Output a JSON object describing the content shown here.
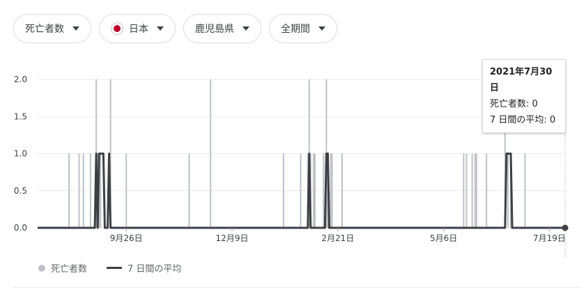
{
  "filters": {
    "metric": "死亡者数",
    "country": "日本",
    "region": "鹿児島県",
    "period": "全期間"
  },
  "tooltip": {
    "date": "2021年7月30日",
    "deaths_label": "死亡者数",
    "deaths_value": "0",
    "avg_label": "7 日間の平均",
    "avg_value": "0"
  },
  "legend": {
    "deaths": "死亡者数",
    "avg": "7 日間の平均"
  },
  "colors": {
    "bars": "#bdc1c6",
    "line": "#3c4043",
    "grid": "#e8eaed",
    "flag": "#bc002d"
  },
  "chart_data": {
    "type": "bar",
    "title": "",
    "xlabel": "",
    "ylabel": "",
    "x_range": [
      "2020-07-26",
      "2021-07-30"
    ],
    "ylim": [
      0,
      2.0
    ],
    "yticks": [
      "0.0",
      "0.5",
      "1.0",
      "1.5",
      "2.0"
    ],
    "xticks": [
      {
        "date": "2020-09-26",
        "label": "9月26日"
      },
      {
        "date": "2020-12-09",
        "label": "12月9日"
      },
      {
        "date": "2021-02-21",
        "label": "2月21日"
      },
      {
        "date": "2021-05-06",
        "label": "5月6日"
      },
      {
        "date": "2021-07-19",
        "label": "7月19日"
      }
    ],
    "grid": true,
    "legend_position": "bottom-left",
    "series": [
      {
        "name": "死亡者数",
        "type": "bar",
        "points": [
          [
            "2020-08-17",
            1
          ],
          [
            "2020-08-24",
            1
          ],
          [
            "2020-08-27",
            1
          ],
          [
            "2020-09-01",
            1
          ],
          [
            "2020-09-05",
            2
          ],
          [
            "2020-09-06",
            1
          ],
          [
            "2020-09-07",
            1
          ],
          [
            "2020-09-08",
            1
          ],
          [
            "2020-09-15",
            2
          ],
          [
            "2020-09-26",
            1
          ],
          [
            "2020-11-09",
            1
          ],
          [
            "2020-11-24",
            2
          ],
          [
            "2021-01-14",
            1
          ],
          [
            "2021-01-26",
            1
          ],
          [
            "2021-01-31",
            1
          ],
          [
            "2021-02-01",
            2
          ],
          [
            "2021-02-02",
            1
          ],
          [
            "2021-02-04",
            1
          ],
          [
            "2021-02-05",
            1
          ],
          [
            "2021-02-11",
            1
          ],
          [
            "2021-02-13",
            2
          ],
          [
            "2021-02-14",
            1
          ],
          [
            "2021-02-16",
            1
          ],
          [
            "2021-02-17",
            1
          ],
          [
            "2021-02-24",
            1
          ],
          [
            "2021-05-20",
            1
          ],
          [
            "2021-05-22",
            1
          ],
          [
            "2021-05-26",
            1
          ],
          [
            "2021-05-28",
            1
          ],
          [
            "2021-05-29",
            1
          ],
          [
            "2021-06-05",
            1
          ],
          [
            "2021-06-18",
            2
          ],
          [
            "2021-06-20",
            1
          ],
          [
            "2021-06-22",
            1
          ],
          [
            "2021-07-02",
            1
          ]
        ]
      },
      {
        "name": "7 日間の平均",
        "type": "line",
        "points": [
          [
            "2020-07-26",
            0
          ],
          [
            "2020-09-04",
            0
          ],
          [
            "2020-09-05",
            1
          ],
          [
            "2020-09-06",
            0
          ],
          [
            "2020-09-07",
            1
          ],
          [
            "2020-09-10",
            1
          ],
          [
            "2020-09-11",
            0
          ],
          [
            "2020-09-13",
            0
          ],
          [
            "2020-09-14",
            1
          ],
          [
            "2020-09-15",
            0
          ],
          [
            "2021-01-31",
            0
          ],
          [
            "2021-02-01",
            1
          ],
          [
            "2021-02-02",
            0
          ],
          [
            "2021-02-12",
            0
          ],
          [
            "2021-02-13",
            1
          ],
          [
            "2021-02-14",
            1
          ],
          [
            "2021-02-15",
            0
          ],
          [
            "2021-06-18",
            0
          ],
          [
            "2021-06-19",
            1
          ],
          [
            "2021-06-22",
            1
          ],
          [
            "2021-06-23",
            0
          ],
          [
            "2021-07-30",
            0
          ]
        ]
      }
    ]
  }
}
